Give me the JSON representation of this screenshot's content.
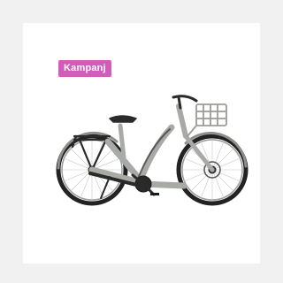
{
  "product_card": {
    "badge_label": "Kampanj",
    "image_icon": "e-bike-icon",
    "colors": {
      "badge": "#d35bb9",
      "frame": "#a7aaa5",
      "tire": "#222222"
    }
  }
}
